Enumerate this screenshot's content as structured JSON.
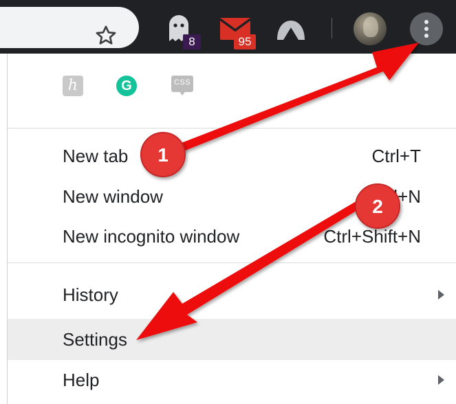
{
  "toolbar": {
    "bookmark_icon": "star-icon",
    "ghostery_icon": "ghost-icon",
    "ghostery_count": "8",
    "mail_icon": "mail-icon",
    "mail_count": "95",
    "vpn_icon": "mountain-icon",
    "avatar": "profile-avatar",
    "menu_icon": "vertical-dots-icon"
  },
  "menu": {
    "extensions": [
      {
        "name": "keep-extension-icon",
        "glyph": "ℎ"
      },
      {
        "name": "grammarly-icon",
        "glyph": "G"
      },
      {
        "name": "css-viewer-icon",
        "glyph": "CSS"
      }
    ],
    "items": [
      {
        "label": "New tab",
        "shortcut": "Ctrl+T"
      },
      {
        "label": "New window",
        "shortcut": "Ctrl+N"
      },
      {
        "label": "New incognito window",
        "shortcut": "Ctrl+Shift+N"
      },
      {
        "label": "History",
        "submenu": "submenu-arrow-icon"
      },
      {
        "label": "Settings"
      },
      {
        "label": "Help",
        "submenu": "submenu-arrow-icon"
      }
    ]
  },
  "annotations": {
    "step1": "1",
    "step2": "2",
    "arrow_color": "#ee0a0a",
    "circle_color": "#e53935"
  },
  "colors": {
    "toolbar_bg": "#202124",
    "menu_highlight": "#ededed",
    "grammarly_green": "#15c39a"
  }
}
